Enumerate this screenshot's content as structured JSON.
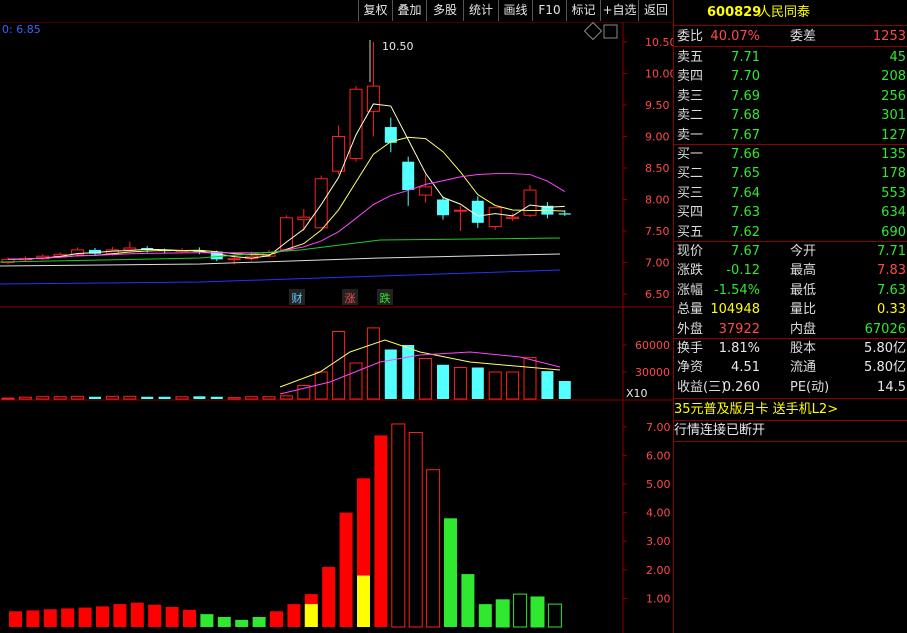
{
  "toolbar": [
    "复权",
    "叠加",
    "多股",
    "统计",
    "画线",
    "F10",
    "标记",
    "+自选",
    "返回"
  ],
  "chart": {
    "top_left_label": "0: 6.85",
    "high_label": "10.50",
    "markers": [
      "财",
      "涨",
      "跌"
    ],
    "vol_scale_label": "X10"
  },
  "stock": {
    "code": "600829",
    "name": "人民同泰"
  },
  "quote": {
    "weibi_label": "委比",
    "weibi": "40.07%",
    "weicha_label": "委差",
    "weicha": "1253",
    "asks": [
      {
        "label": "卖五",
        "price": "7.71",
        "vol": "45"
      },
      {
        "label": "卖四",
        "price": "7.70",
        "vol": "208"
      },
      {
        "label": "卖三",
        "price": "7.69",
        "vol": "256"
      },
      {
        "label": "卖二",
        "price": "7.68",
        "vol": "301"
      },
      {
        "label": "卖一",
        "price": "7.67",
        "vol": "127"
      }
    ],
    "bids": [
      {
        "label": "买一",
        "price": "7.66",
        "vol": "135"
      },
      {
        "label": "买二",
        "price": "7.65",
        "vol": "178"
      },
      {
        "label": "买三",
        "price": "7.64",
        "vol": "553"
      },
      {
        "label": "买四",
        "price": "7.63",
        "vol": "634"
      },
      {
        "label": "买五",
        "price": "7.62",
        "vol": "690"
      }
    ],
    "stats": [
      {
        "l1": "现价",
        "v1": "7.67",
        "c1": "green",
        "l2": "今开",
        "v2": "7.71",
        "c2": "green"
      },
      {
        "l1": "涨跌",
        "v1": "-0.12",
        "c1": "green",
        "l2": "最高",
        "v2": "7.83",
        "c2": "red"
      },
      {
        "l1": "涨幅",
        "v1": "-1.54%",
        "c1": "green",
        "l2": "最低",
        "v2": "7.63",
        "c2": "green"
      },
      {
        "l1": "总量",
        "v1": "104948",
        "c1": "yellow",
        "l2": "量比",
        "v2": "0.33",
        "c2": "yellow"
      },
      {
        "l1": "外盘",
        "v1": "37922",
        "c1": "red",
        "l2": "内盘",
        "v2": "67026",
        "c2": "green"
      }
    ],
    "stats2": [
      {
        "l1": "换手",
        "v1": "1.81%",
        "l2": "股本",
        "v2": "5.80亿"
      },
      {
        "l1": "净资",
        "v1": "4.51",
        "l2": "流通",
        "v2": "5.80亿"
      },
      {
        "l1": "收益(三)",
        "v1": "0.260",
        "l2": "PE(动)",
        "v2": "14.5"
      }
    ],
    "ad": "35元普及版月卡 送手机L2>",
    "status": "行情连接已断开"
  },
  "colors": {
    "up": "#ff2020",
    "down": "#54ffff",
    "dark_red": "#8b0000",
    "ma1": "#ffffcc",
    "ma2": "#ffff66",
    "ma3": "#ff44ff",
    "ma4": "#22cc22",
    "ma5": "#dddddd",
    "ma6": "#2233ff"
  },
  "chart_data": {
    "type": "candlestick",
    "price_axis_ticks": [
      "10.50",
      "10.00",
      "9.50",
      "9.00",
      "8.50",
      "8.00",
      "7.50",
      "7.00",
      "6.50"
    ],
    "volume_axis_ticks": [
      "60000",
      "30000"
    ],
    "indicator_axis_ticks": [
      "7.00",
      "6.00",
      "5.00",
      "4.00",
      "3.00",
      "2.00",
      "1.00"
    ],
    "candles": [
      {
        "o": 7.0,
        "c": 7.05,
        "h": 7.08,
        "l": 6.97
      },
      {
        "o": 7.05,
        "c": 7.06,
        "h": 7.1,
        "l": 7.02
      },
      {
        "o": 7.06,
        "c": 7.1,
        "h": 7.13,
        "l": 7.04
      },
      {
        "o": 7.1,
        "c": 7.13,
        "h": 7.16,
        "l": 7.07
      },
      {
        "o": 7.13,
        "c": 7.2,
        "h": 7.24,
        "l": 7.1
      },
      {
        "o": 7.2,
        "c": 7.14,
        "h": 7.23,
        "l": 7.11
      },
      {
        "o": 7.14,
        "c": 7.2,
        "h": 7.25,
        "l": 7.11
      },
      {
        "o": 7.2,
        "c": 7.23,
        "h": 7.33,
        "l": 7.18
      },
      {
        "o": 7.23,
        "c": 7.2,
        "h": 7.26,
        "l": 7.16
      },
      {
        "o": 7.2,
        "c": 7.18,
        "h": 7.22,
        "l": 7.14
      },
      {
        "o": 7.18,
        "c": 7.19,
        "h": 7.23,
        "l": 7.15
      },
      {
        "o": 7.19,
        "c": 7.17,
        "h": 7.24,
        "l": 7.13
      },
      {
        "o": 7.17,
        "c": 7.05,
        "h": 7.19,
        "l": 7.02
      },
      {
        "o": 7.05,
        "c": 7.06,
        "h": 7.15,
        "l": 6.97
      },
      {
        "o": 7.06,
        "c": 7.1,
        "h": 7.17,
        "l": 7.03
      },
      {
        "o": 7.1,
        "c": 7.16,
        "h": 7.2,
        "l": 7.08
      },
      {
        "o": 7.2,
        "c": 7.71,
        "h": 7.75,
        "l": 7.18
      },
      {
        "o": 7.68,
        "c": 7.72,
        "h": 7.85,
        "l": 7.5
      },
      {
        "o": 7.55,
        "c": 8.33,
        "h": 8.38,
        "l": 7.55
      },
      {
        "o": 8.45,
        "c": 9.0,
        "h": 9.18,
        "l": 8.4
      },
      {
        "o": 8.65,
        "c": 9.75,
        "h": 9.8,
        "l": 8.6
      },
      {
        "o": 9.4,
        "c": 9.8,
        "h": 10.5,
        "l": 9.0
      },
      {
        "o": 9.15,
        "c": 8.9,
        "h": 9.3,
        "l": 8.75
      },
      {
        "o": 8.6,
        "c": 8.15,
        "h": 8.68,
        "l": 7.9
      },
      {
        "o": 8.07,
        "c": 8.2,
        "h": 8.4,
        "l": 7.95
      },
      {
        "o": 8.0,
        "c": 7.75,
        "h": 8.05,
        "l": 7.68
      },
      {
        "o": 7.83,
        "c": 7.83,
        "h": 7.9,
        "l": 7.5
      },
      {
        "o": 7.98,
        "c": 7.63,
        "h": 8.05,
        "l": 7.55
      },
      {
        "o": 7.57,
        "c": 7.87,
        "h": 7.87,
        "l": 7.52
      },
      {
        "o": 7.7,
        "c": 7.72,
        "h": 7.78,
        "l": 7.66
      },
      {
        "o": 7.75,
        "c": 8.15,
        "h": 8.23,
        "l": 7.72
      },
      {
        "o": 7.9,
        "c": 7.76,
        "h": 7.96,
        "l": 7.7
      },
      {
        "o": 7.78,
        "c": 7.76,
        "h": 7.83,
        "l": 7.74
      }
    ],
    "volumes": [
      1000,
      2000,
      2500,
      2500,
      3000,
      2500,
      3000,
      3000,
      2500,
      2500,
      2500,
      3000,
      2500,
      1500,
      2500,
      2500,
      3500,
      15000,
      30000,
      75000,
      40000,
      79000,
      55000,
      60000,
      45000,
      38000,
      35000,
      35000,
      30000,
      30000,
      46000,
      31000,
      20000
    ],
    "indicator": [
      0.55,
      0.58,
      0.62,
      0.65,
      0.68,
      0.72,
      0.8,
      0.85,
      0.78,
      0.7,
      0.6,
      0.45,
      0.35,
      0.25,
      0.35,
      0.55,
      0.8,
      1.15,
      2.1,
      4.0,
      5.2,
      6.7,
      7.1,
      6.8,
      5.5,
      3.8,
      1.85,
      0.8,
      0.95,
      1.15,
      1.05,
      0.8
    ],
    "indicator_yellow": {
      "17": 0.8,
      "20": 1.8
    }
  }
}
